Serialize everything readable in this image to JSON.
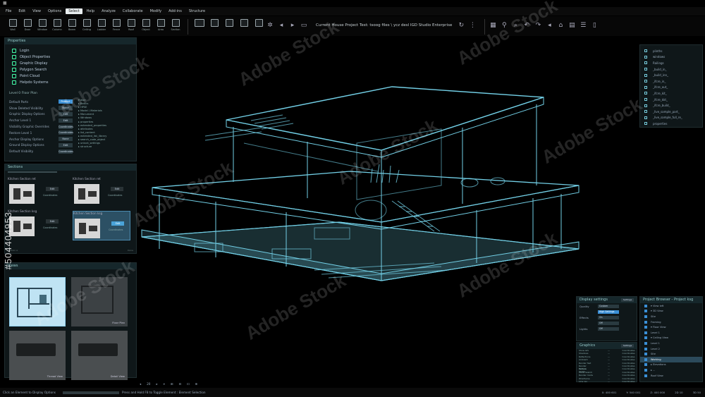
{
  "window": {
    "title_mark": "■"
  },
  "menu": [
    "File",
    "Edit",
    "View",
    "Options",
    "Select",
    "Help",
    "Analyze",
    "Collaborate",
    "Modify",
    "Add-ins",
    "Structure"
  ],
  "menu_active_index": 4,
  "toolbar": {
    "buttons": [
      "Wall",
      "Door",
      "Window",
      "Column",
      "Beam",
      "Ceiling",
      "Ladder",
      "Fence",
      "Roof",
      "Object",
      "Area",
      "Section"
    ],
    "project_title_prefix": "Current House Project Test:",
    "project_title_path": "tsoog files \\ ycz desl IGD Studio Enterprise"
  },
  "properties": {
    "title": "Properties",
    "items": [
      "Login",
      "Object Properties",
      "Graphic Display",
      "Polygon Search",
      "Point Cloud",
      "Helpdo Systems"
    ],
    "floor_plan_label": "Level 0 Floor Plan",
    "rows": [
      {
        "label": "Default Parts",
        "value": "Product"
      },
      {
        "label": "Show Deleted Visibility",
        "value": "None"
      },
      {
        "label": "Graphic Display Options",
        "value": "Edit"
      },
      {
        "label": "Anchor Level 1",
        "value": "Edit"
      },
      {
        "label": "Visibility Graphic Overrides",
        "value": "Coordinates"
      },
      {
        "label": "Restore Level 1",
        "value": "Coordinates"
      },
      {
        "label": "Anchor Display Options",
        "value": "None"
      },
      {
        "label": "Ground Display Options",
        "value": "Edit"
      },
      {
        "label": "Default Visibility",
        "value": "Coordinates"
      }
    ],
    "tree": [
      "▾ dscr",
      "  ▸ Basics",
      "    ▸ HPSE",
      "    ▸ Model / Materials",
      "      ▸ Monument",
      "  ▸ Windows",
      "    ▸ properties",
      "      ▸ extended_properties",
      "    ▸ attributes",
      "  ▸ list_content",
      "    ▸ extended_list_library",
      "      ▸ search_code_object",
      "      ▸ unlock_settings",
      "      ▸ structure"
    ]
  },
  "sections": {
    "title": "Sections",
    "thumbs": [
      {
        "caption": "Kitchen Section ret",
        "button": "Edit",
        "sub": "Coordinates"
      },
      {
        "caption": "Kitchen Section ret",
        "button": "Edit",
        "sub": "Coordinates"
      },
      {
        "caption": "Kitchen Section ksg",
        "button": "Edit",
        "sub": "Coordinates"
      },
      {
        "caption": "Kitchen Section ksg",
        "button": "Edit",
        "sub": "Coordinates"
      }
    ],
    "footer_left": "Section A",
    "footer_right": "Done"
  },
  "views": {
    "title": "Views",
    "thumbs": [
      {
        "caption": ""
      },
      {
        "caption": "Floor Plan"
      },
      {
        "caption": "Thread View"
      },
      {
        "caption": "Detail View"
      }
    ]
  },
  "layers": [
    "plinths",
    "windows",
    "Railings",
    "_build_in_",
    "_build_inn_",
    "_ifcre_in_",
    "_ifcre_out_",
    "_ifcre_kit_",
    "_ifcre_kkt_",
    "_ifcre_build_",
    "_live_sample_part_",
    "_live_sample_full_re_",
    "properties"
  ],
  "display_settings": {
    "title": "Display settings",
    "button": "Settings",
    "rows": [
      {
        "label": "Quality",
        "value": "Custom"
      },
      {
        "label": "",
        "value": "High Settings"
      },
      {
        "label": "Effects",
        "value": "On"
      },
      {
        "label": "",
        "value": "Off"
      },
      {
        "label": "Lights",
        "value": "Off"
      }
    ]
  },
  "graphics": {
    "title": "Graphics",
    "button": "Settings",
    "rows": [
      [
        "Show Gfx",
        "",
        "—",
        "Coordinates"
      ],
      [
        "Shadows",
        "",
        "—",
        "Coordinates"
      ],
      [
        "Reflections",
        "",
        "—",
        "Coordinates"
      ],
      [
        "Ambient",
        "",
        "—",
        "Coordinates"
      ],
      [
        "Render fast",
        "",
        "—",
        "Coordinates"
      ],
      [
        "Render reduce",
        "",
        "—",
        "Coordinates"
      ],
      [
        "Texture depth",
        "",
        "—",
        "Coordinates"
      ],
      [
        "Show Sketch",
        "",
        "—",
        "Coordinates"
      ],
      [
        "Render mode",
        "",
        "—",
        "Coordinates"
      ],
      [
        "Wireframe",
        "",
        "—",
        "Coordinates"
      ],
      [
        "Line res",
        "",
        "—",
        "Coordinates"
      ]
    ]
  },
  "browser": {
    "title": "Project Browser - Project ksg",
    "items": [
      {
        "label": "▾ View left",
        "sel": false
      },
      {
        "label": "▾ 3D View",
        "sel": false
      },
      {
        "label": "  Site",
        "sel": false
      },
      {
        "label": "  Framing",
        "sel": false
      },
      {
        "label": "▾ Floor View",
        "sel": false
      },
      {
        "label": "  Level 1",
        "sel": false
      },
      {
        "label": "▾ Ceiling View",
        "sel": false
      },
      {
        "label": "  Level 1",
        "sel": false
      },
      {
        "label": "  Level 2",
        "sel": false
      },
      {
        "label": "  Site",
        "sel": false
      },
      {
        "label": "  Working",
        "sel": true
      },
      {
        "label": "▸ Elevations",
        "sel": false
      },
      {
        "label": "▸ ...",
        "sel": false
      },
      {
        "label": "  Roof View",
        "sel": false
      }
    ]
  },
  "status": {
    "left": "Click an Element to Display Options",
    "hint": "Press and Hold F8 to Toggle Element : Element Selection",
    "right": [
      "X: 400 601",
      "Y: 540 001",
      "Z: 400 000",
      "2D 10",
      "3D 50"
    ]
  },
  "viewport_footer": [
    "◂",
    "20",
    "▸",
    "⌖",
    "⊞",
    "⊟",
    "⊡",
    "⊕"
  ],
  "watermark": "Adobe Stock",
  "side_id": "#504404953",
  "colors": {
    "accent": "#3a8fd6",
    "wire": "#7fe6ff"
  }
}
